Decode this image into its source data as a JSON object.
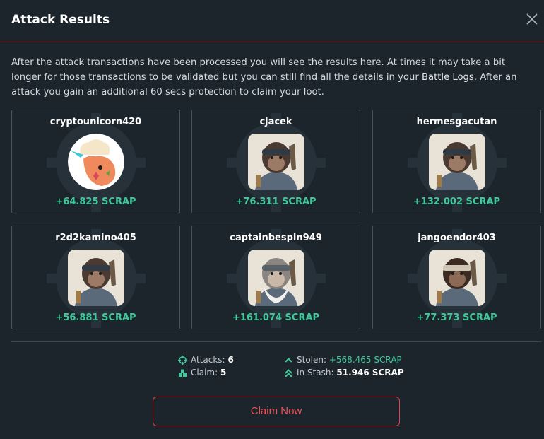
{
  "modal": {
    "title": "Attack Results",
    "intro_part1": "After the attack transactions have been processed you will see the results here. At times it may take a bit longer for those transactions to be validated but you can still find all the details in your ",
    "intro_link": "Battle Logs",
    "intro_part2": ". After an attack you gain an additional 60 secs protection to claim your loot."
  },
  "results": [
    {
      "name": "cryptounicorn420",
      "reward": "+64.825 SCRAP",
      "avatar": "unicorn-avatar"
    },
    {
      "name": "cjacek",
      "reward": "+76.311 SCRAP",
      "avatar": "ape-avatar"
    },
    {
      "name": "hermesgacutan",
      "reward": "+132.002 SCRAP",
      "avatar": "ape-avatar"
    },
    {
      "name": "r2d2kamino405",
      "reward": "+56.881 SCRAP",
      "avatar": "ape-avatar"
    },
    {
      "name": "captainbespin949",
      "reward": "+161.074 SCRAP",
      "avatar": "old-ape-avatar"
    },
    {
      "name": "jangoendor403",
      "reward": "+77.373 SCRAP",
      "avatar": "hooded-ape-avatar"
    }
  ],
  "stats": {
    "attacks_label": "Attacks:",
    "attacks_value": "6",
    "claim_label": "Claim:",
    "claim_value": "5",
    "stolen_label": "Stolen:",
    "stolen_value": "+568.465 SCRAP",
    "stash_label": "In Stash:",
    "stash_value": "51.946 SCRAP"
  },
  "claim_button": "Claim Now",
  "colors": {
    "background": "#1d252c",
    "accent_red": "#d9484f",
    "reward_green": "#3ec99a",
    "card_border": "#48525b"
  }
}
